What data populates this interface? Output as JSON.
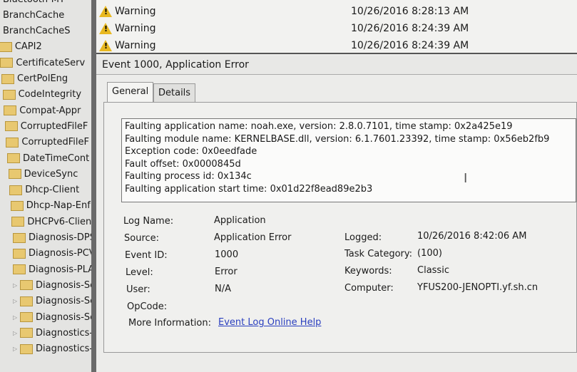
{
  "tree": [
    "Bluetooth-MT",
    "BranchCache",
    "BranchCacheS",
    "CAPI2",
    "CertificateServ",
    "CertPolEng",
    "CodeIntegrity",
    "Compat-Appr",
    "CorruptedFileF",
    "CorruptedFileF",
    "DateTimeCont",
    "DeviceSync",
    "Dhcp-Client",
    "Dhcp-Nap-Enf",
    "DHCPv6-Clien",
    "Diagnosis-DPS",
    "Diagnosis-PCV",
    "Diagnosis-PLA",
    "Diagnosis-Sch",
    "Diagnosis-Scri",
    "Diagnosis-Scri",
    "Diagnostics-N",
    "Diagnostics-Pe"
  ],
  "events": [
    {
      "level": "Warning",
      "date": "10/26/2016 8:28:13 AM"
    },
    {
      "level": "Warning",
      "date": "10/26/2016 8:24:39 AM"
    },
    {
      "level": "Warning",
      "date": "10/26/2016 8:24:39 AM"
    }
  ],
  "header": "Event 1000, Application Error",
  "tabs": [
    "General",
    "Details"
  ],
  "description": [
    "Faulting application name: noah.exe, version: 2.8.0.7101, time stamp: 0x2a425e19",
    "Faulting module name: KERNELBASE.dll, version: 6.1.7601.23392, time stamp: 0x56eb2fb9",
    "Exception code: 0x0eedfade",
    "Fault offset: 0x0000845d",
    "Faulting process id: 0x134c",
    "Faulting application start time: 0x01d22f8ead89e2b3"
  ],
  "fields": {
    "log_name": {
      "label": "Log Name:",
      "value": "Application"
    },
    "source": {
      "label": "Source:",
      "value": "Application Error"
    },
    "event_id": {
      "label": "Event ID:",
      "value": "1000"
    },
    "level": {
      "label": "Level:",
      "value": "Error"
    },
    "user": {
      "label": "User:",
      "value": "N/A"
    },
    "opcode": {
      "label": "OpCode:",
      "value": ""
    },
    "more_info": {
      "label": "More Information:",
      "value": "Event Log Online Help"
    },
    "logged": {
      "label": "Logged:",
      "value": "10/26/2016 8:42:06 AM"
    },
    "task_category": {
      "label": "Task Category:",
      "value": "(100)"
    },
    "keywords": {
      "label": "Keywords:",
      "value": "Classic"
    },
    "computer": {
      "label": "Computer:",
      "value": "YFUS200-JENOPTI.yf.sh.cn"
    }
  }
}
